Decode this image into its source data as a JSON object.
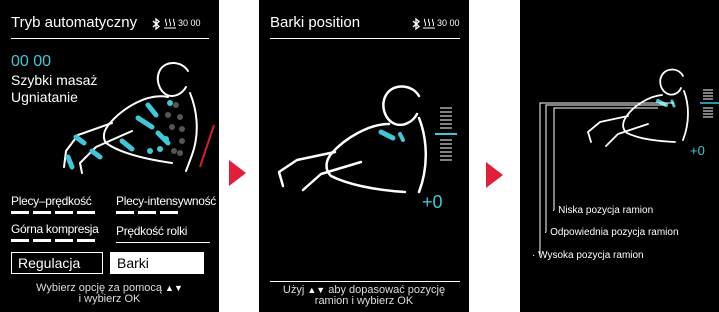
{
  "screen1": {
    "title": "Tryb automatyczny",
    "status": "30 00",
    "timer": "00 00",
    "program_line1": "Szybki masaż",
    "program_line2": "Ugniatanie",
    "options": {
      "back_speed": "Plecy–prędkość",
      "back_intensity": "Plecy-intensywność",
      "upper_compression": "Górna kompresja",
      "roller_speed": "Prędkość rolki"
    },
    "adjust_label": "Regulacja",
    "selected_value": "Barki",
    "hint_line1": "Wybierz opcję za pomocą",
    "hint_arrows": "▲▼",
    "hint_line2": "i wybierz OK"
  },
  "screen2": {
    "title": "Barki position",
    "status": "30 00",
    "value": "+0",
    "hint_line1_pre": "Użyj",
    "hint_arrows": "▲▼",
    "hint_line1_post": "aby dopasować pozycję",
    "hint_line2": "ramion i wybierz OK"
  },
  "screen3": {
    "value": "+0",
    "labels": {
      "low": "Niska pozycja ramion",
      "proper": "Odpowiednia pozycja ramion",
      "high": "Wysoka pozycja ramion"
    }
  },
  "colors": {
    "accent": "#3ec8d8",
    "arrow": "#e0203a",
    "alert": "#d4202c"
  },
  "icons": [
    "bluetooth-icon",
    "heat-icon",
    "next-arrow-icon",
    "up-down-arrows-icon"
  ]
}
